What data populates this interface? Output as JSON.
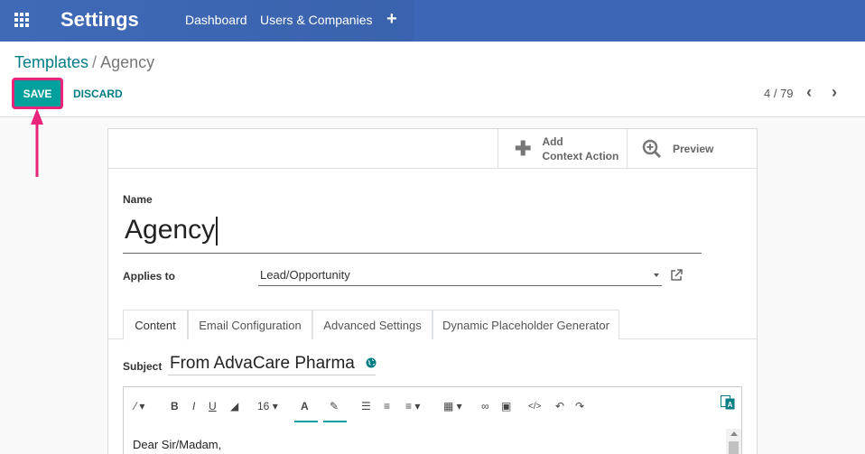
{
  "navbar": {
    "icon": "apps-grid-icon",
    "app_title": "Settings",
    "menu": [
      "Dashboard",
      "Users & Companies"
    ],
    "plus": "+"
  },
  "breadcrumb": {
    "parent": "Templates",
    "separator": "/",
    "current": "Agency"
  },
  "actions": {
    "save": "SAVE",
    "discard": "DISCARD"
  },
  "pager": {
    "value": "4 / 79",
    "prev": "‹",
    "next": "›"
  },
  "smart_buttons": {
    "context_action_line1": "Add",
    "context_action_line2": "Context Action",
    "preview": "Preview"
  },
  "form": {
    "name_label": "Name",
    "name_value": "Agency",
    "applies_label": "Applies to",
    "applies_value": "Lead/Opportunity"
  },
  "tabs": [
    "Content",
    "Email Configuration",
    "Advanced Settings",
    "Dynamic Placeholder Generator"
  ],
  "active_tab": "Content",
  "subject": {
    "label": "Subject",
    "value": "From AdvaCare Pharma"
  },
  "editor": {
    "font_size": "16",
    "body_first_line": "Dear Sir/Madam,"
  },
  "colors": {
    "accent": "#00a09d",
    "navbar": "#3f6ab7",
    "highlight": "#e8247b"
  }
}
